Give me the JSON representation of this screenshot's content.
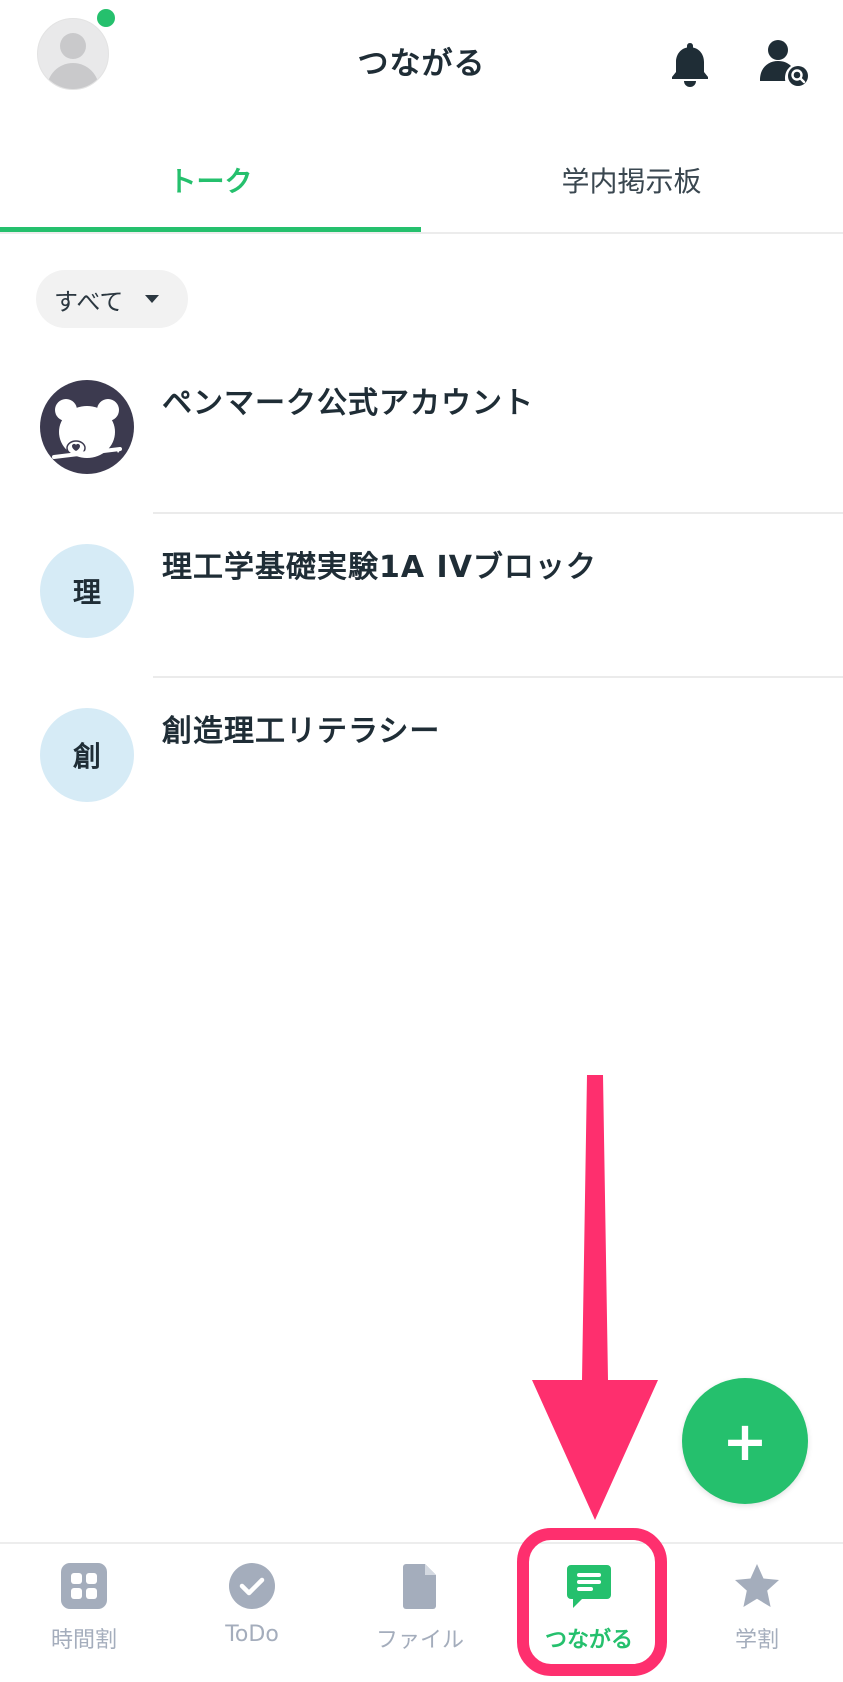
{
  "header": {
    "title": "つながる",
    "online_status_color": "#25c06d"
  },
  "tabs": [
    {
      "label": "トーク",
      "active": true
    },
    {
      "label": "学内掲示板",
      "active": false
    }
  ],
  "filter": {
    "selected": "すべて"
  },
  "talk_list": [
    {
      "name": "ペンマーク公式アカウント",
      "avatar_type": "mascot-image"
    },
    {
      "name": "理工学基礎実験1A IVブロック",
      "avatar_initial": "理"
    },
    {
      "name": "創造理工リテラシー",
      "avatar_initial": "創"
    }
  ],
  "fab": {
    "label": "+"
  },
  "bottom_nav": [
    {
      "label": "時間割",
      "icon": "grid-icon",
      "active": false
    },
    {
      "label": "ToDo",
      "icon": "check-circle-icon",
      "active": false
    },
    {
      "label": "ファイル",
      "icon": "file-icon",
      "active": false
    },
    {
      "label": "つながる",
      "icon": "chat-bubble-icon",
      "active": true
    },
    {
      "label": "学割",
      "icon": "star-icon",
      "active": false
    }
  ],
  "colors": {
    "accent": "#25c06d",
    "inactive_nav": "#a4adbc",
    "annotation": "#fe2f6e"
  }
}
